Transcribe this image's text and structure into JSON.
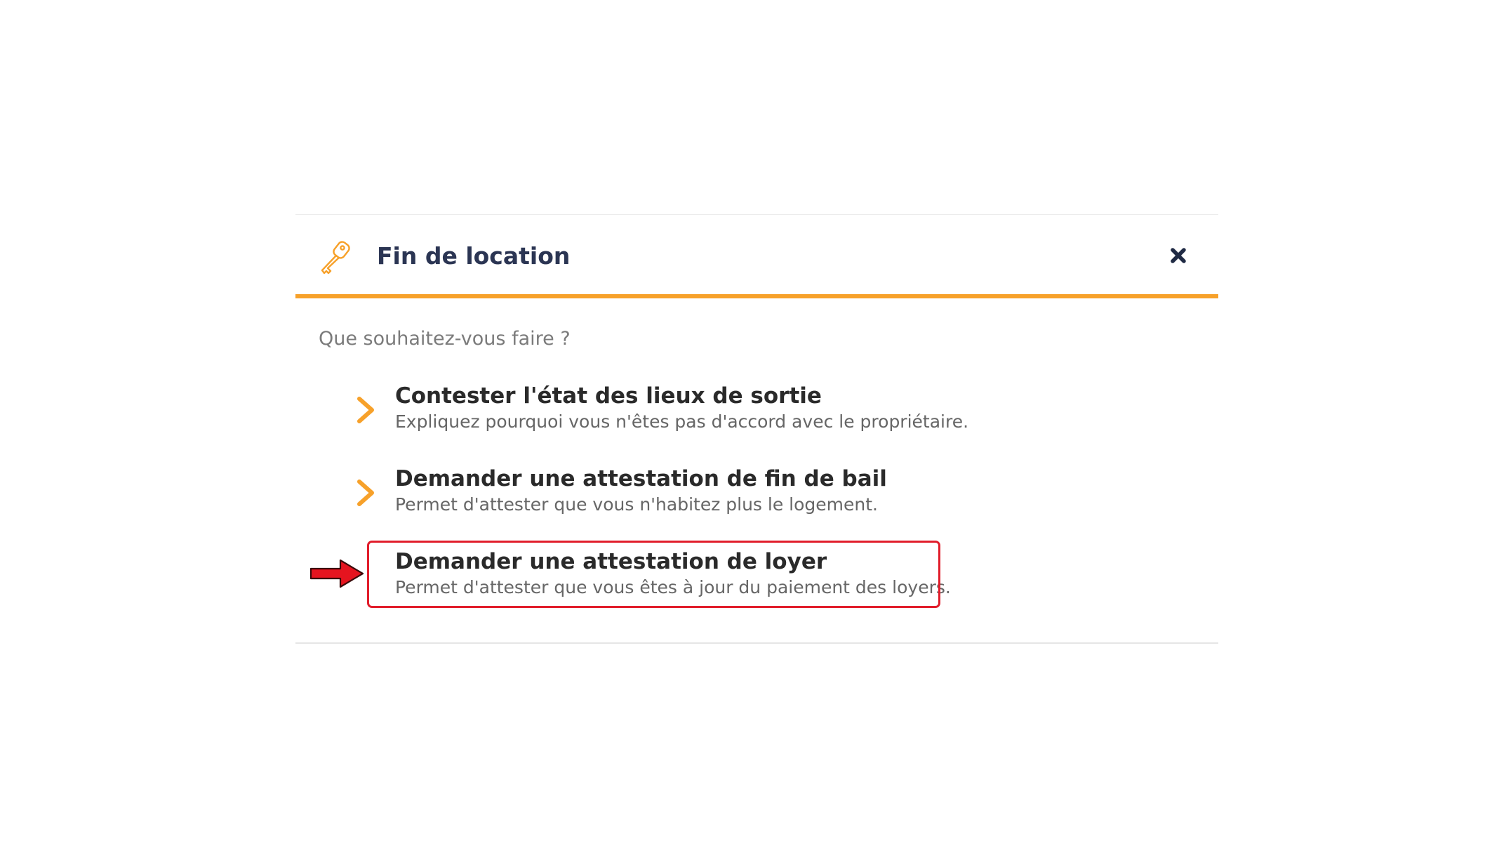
{
  "dialog": {
    "title": "Fin de location",
    "icon": "key-icon",
    "close_icon": "close-icon",
    "accent_color": "#f7a12a",
    "title_color": "#2b3553"
  },
  "question": "Que souhaitez-vous faire ?",
  "options": [
    {
      "title": "Contester l'état des lieux de sortie",
      "description": "Expliquez pourquoi vous n'êtes pas d'accord avec le propriétaire.",
      "icon": "chevron-right-icon"
    },
    {
      "title": "Demander une attestation de fin de bail",
      "description": "Permet d'attester que vous n'habitez plus le logement.",
      "icon": "chevron-right-icon"
    },
    {
      "title": "Demander une attestation de loyer",
      "description": "Permet d'attester que vous êtes à jour du paiement des loyers.",
      "highlighted": true,
      "highlight_color": "#e11d2b",
      "pointer_icon": "red-arrow-icon"
    }
  ]
}
